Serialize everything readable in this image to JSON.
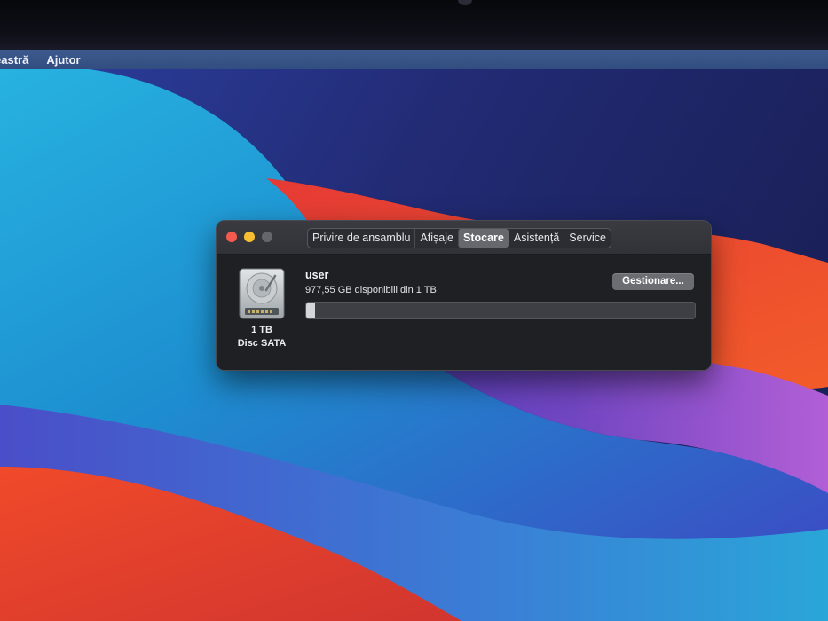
{
  "menubar": {
    "items": [
      "eastră",
      "Ajutor"
    ]
  },
  "window": {
    "tabs": [
      "Privire de ansamblu",
      "Afișaje",
      "Stocare",
      "Asistență",
      "Service"
    ],
    "active_tab": "Stocare"
  },
  "storage": {
    "disk_capacity": "1 TB",
    "disk_type": "Disc SATA",
    "volume_name": "user",
    "volume_info": "977,55 GB disponibili din 1 TB",
    "manage_button": "Gestionare...",
    "used_fraction": 0.022,
    "disk_icon": "hard-drive-icon"
  },
  "colors": {
    "close": "#f25a50",
    "minimize": "#f6bf33",
    "zoom_inactive": "#65666b",
    "menubar": "#3d5a8e"
  }
}
